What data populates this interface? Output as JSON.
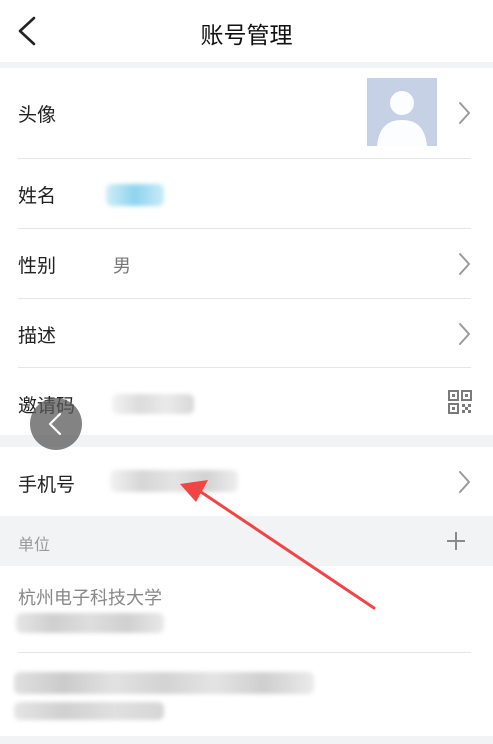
{
  "header": {
    "title": "账号管理",
    "back_icon": "chevron-left-icon"
  },
  "rows": {
    "avatar": {
      "label": "头像"
    },
    "name": {
      "label": "姓名",
      "value": ""
    },
    "gender": {
      "label": "性别",
      "value": "男"
    },
    "description": {
      "label": "描述"
    },
    "invite_code": {
      "label": "邀请码",
      "value": "",
      "qr_icon": "qr-code-icon"
    },
    "phone": {
      "label": "手机号",
      "value": ""
    }
  },
  "section": {
    "label": "单位",
    "add_icon": "plus-icon"
  },
  "units": [
    {
      "name": "杭州电子科技大学"
    }
  ],
  "colors": {
    "accent_red": "#f24444",
    "avatar_bg": "#c7d1e6"
  }
}
